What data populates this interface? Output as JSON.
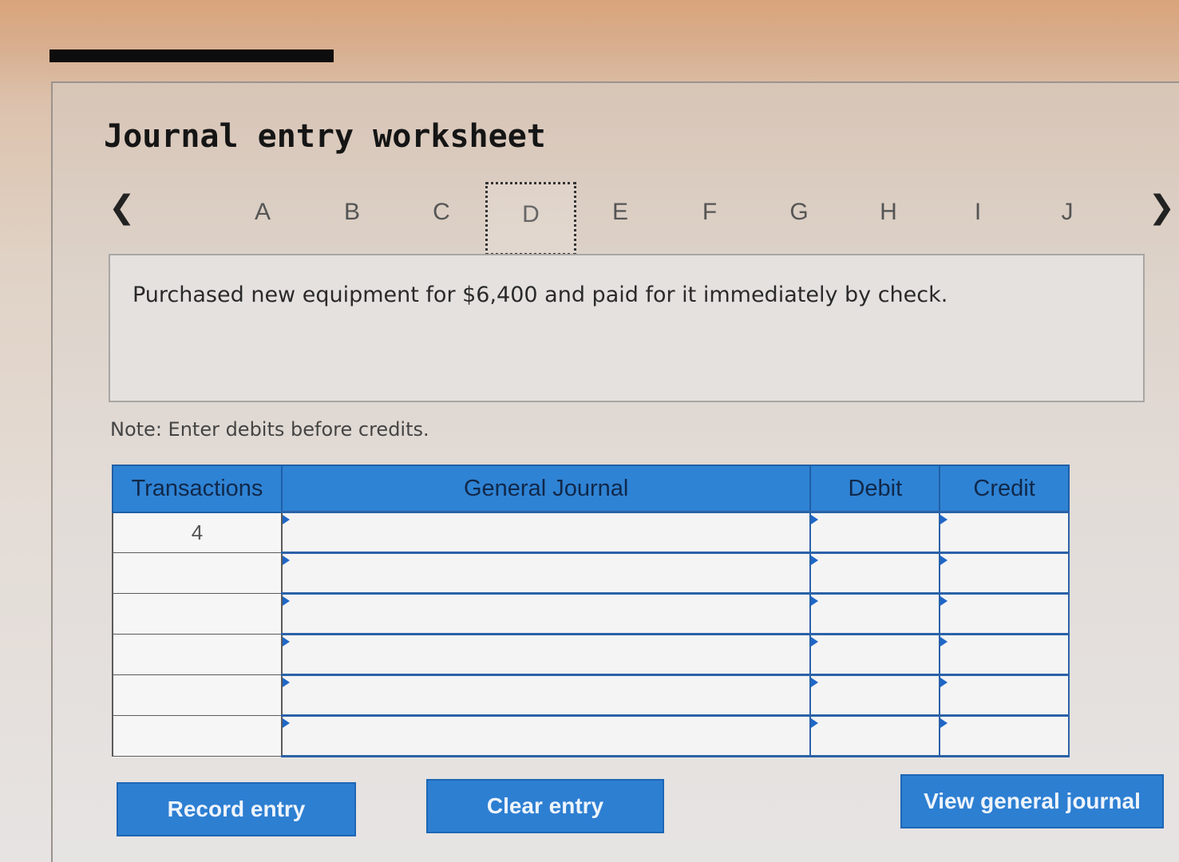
{
  "page": {
    "title": "Journal entry worksheet"
  },
  "nav": {
    "prev_icon": "chevron-left-icon",
    "next_icon": "chevron-right-icon",
    "prev_glyph": "❮",
    "next_glyph": "❯",
    "tabs": [
      "A",
      "B",
      "C",
      "D",
      "E",
      "F",
      "G",
      "H",
      "I",
      "J"
    ],
    "active_tab": "D"
  },
  "description": "Purchased new equipment for $6,400 and paid for it immediately by check.",
  "note": "Note: Enter debits before credits.",
  "table": {
    "headers": {
      "transactions": "Transactions",
      "general_journal": "General Journal",
      "debit": "Debit",
      "credit": "Credit"
    },
    "rows": [
      {
        "transaction": "4",
        "account": "",
        "debit": "",
        "credit": ""
      },
      {
        "transaction": "",
        "account": "",
        "debit": "",
        "credit": ""
      },
      {
        "transaction": "",
        "account": "",
        "debit": "",
        "credit": ""
      },
      {
        "transaction": "",
        "account": "",
        "debit": "",
        "credit": ""
      },
      {
        "transaction": "",
        "account": "",
        "debit": "",
        "credit": ""
      },
      {
        "transaction": "",
        "account": "",
        "debit": "",
        "credit": ""
      }
    ]
  },
  "buttons": {
    "record_entry": "Record entry",
    "clear_entry": "Clear entry",
    "view_general_journal": "View general journal"
  },
  "colors": {
    "accent": "#2d7fd2",
    "header_blue": "#2f83d4",
    "border_blue": "#2b62a8"
  }
}
